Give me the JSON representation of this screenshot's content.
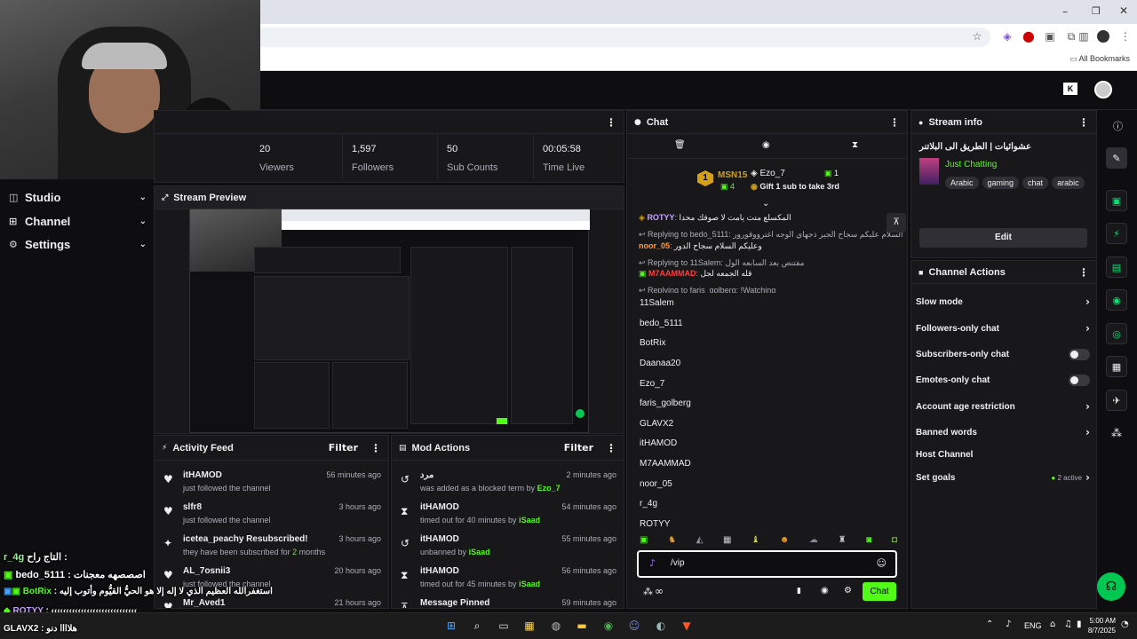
{
  "browser": {
    "bookmarks_label": "All Bookmarks"
  },
  "left_nav": [
    {
      "label": "Studio",
      "icon": "studio-icon"
    },
    {
      "label": "Channel",
      "icon": "channel-icon"
    },
    {
      "label": "Settings",
      "icon": "gear-icon"
    }
  ],
  "stats": [
    {
      "value": "20",
      "label": "Viewers"
    },
    {
      "value": "1,597",
      "label": "Followers"
    },
    {
      "value": "50",
      "label": "Sub Counts"
    },
    {
      "value": "00:05:58",
      "label": "Time Live"
    }
  ],
  "stream_preview": {
    "title": "Stream Preview"
  },
  "activity_feed": {
    "title": "Activity Feed",
    "filter": "Filter",
    "items": [
      {
        "name": "itHAMOD",
        "desc": "just followed the channel",
        "time": "56 minutes ago",
        "icon": "heart-icon"
      },
      {
        "name": "slfr8",
        "desc": "just followed the channel",
        "time": "3 hours ago",
        "icon": "heart-icon"
      },
      {
        "name": "icetea_peachy Resubscribed!",
        "desc": "they have been subscribed for",
        "desc_highlight": "2",
        "desc_suffix": "months",
        "time": "3 hours ago",
        "icon": "sparkle-icon"
      },
      {
        "name": "AL_7osnii3",
        "desc": "just followed the channel",
        "time": "20 hours ago",
        "icon": "heart-icon"
      },
      {
        "name": "Mr_Aved1",
        "desc": "",
        "time": "21 hours ago",
        "icon": "heart-icon"
      }
    ]
  },
  "mod_actions": {
    "title": "Mod Actions",
    "filter": "Filter",
    "items": [
      {
        "name": "مرد",
        "desc": "was added as a blocked term by",
        "by": "Ezo_7",
        "time": "2 minutes ago",
        "icon": "undo-icon"
      },
      {
        "name": "itHAMOD",
        "desc": "timed out for 40 minutes by",
        "by": "iSaad",
        "time": "54 minutes ago",
        "icon": "hourglass-icon"
      },
      {
        "name": "itHAMOD",
        "desc": "unbanned by",
        "by": "iSaad",
        "time": "55 minutes ago",
        "icon": "undo-icon"
      },
      {
        "name": "itHAMOD",
        "desc": "timed out for 45 minutes by",
        "by": "iSaad",
        "time": "56 minutes ago",
        "icon": "hourglass-icon"
      },
      {
        "name": "Message Pinned",
        "desc": "",
        "by": "",
        "time": "59 minutes ago",
        "icon": "pin-icon"
      }
    ]
  },
  "chat": {
    "title": "Chat",
    "leader1": {
      "name": "MSN15",
      "rank": "1",
      "count": "4"
    },
    "leader2": {
      "name": "Ezo_7",
      "count": "1"
    },
    "gift_text": "Gift 1 sub to take 3rd",
    "messages": [
      {
        "user": "ROTYY",
        "text": "المكسلع متت يامت لا صوفك محدا"
      },
      {
        "reply": "Replying to bedo_5111: السلام عليكم سجاح الجير ذجهاي الوجه اغترووقورور"
      },
      {
        "user": "noor_05",
        "text": "وعليكم السلام سجاح الدور"
      },
      {
        "reply": "Replying to 11Salem: مفتنص بعد السابعه الول"
      },
      {
        "user": "M7AAMMAD",
        "text": "قله الجمعه لجل"
      },
      {
        "reply": "Replying to faris_golberg: !Watching"
      }
    ],
    "users": [
      "11Salem",
      "bedo_5111",
      "BotRix",
      "Daanaa20",
      "Ezo_7",
      "faris_golberg",
      "GLAVX2",
      "itHAMOD",
      "M7AAMMAD",
      "noor_05",
      "r_4g",
      "ROTYY"
    ],
    "input_value": "/vip",
    "send_label": "Chat"
  },
  "stream_info": {
    "title": "Stream info",
    "stream_title": "عشوائيات | الطريق الى البلاتنر",
    "category": "Just Chatting",
    "tags": [
      "Arabic",
      "gaming",
      "chat",
      "arabic"
    ],
    "edit_label": "Edit"
  },
  "channel_actions": {
    "title": "Channel Actions",
    "items": [
      {
        "label": "Slow mode",
        "type": "chevron"
      },
      {
        "label": "Followers-only chat",
        "type": "chevron"
      },
      {
        "label": "Subscribers-only chat",
        "type": "toggle"
      },
      {
        "label": "Emotes-only chat",
        "type": "toggle"
      },
      {
        "label": "Account age restriction",
        "type": "chevron"
      },
      {
        "label": "Banned words",
        "type": "chevron"
      },
      {
        "label": "Host Channel",
        "type": "none"
      },
      {
        "label": "Set goals",
        "type": "chevron",
        "badge": "2 active"
      }
    ]
  },
  "overlay_chat": [
    {
      "user": "r_4g",
      "text": "التاج راح :"
    },
    {
      "user": "bedo_5111",
      "text": ": اصصصهه معجنات"
    },
    {
      "user": "BotRix",
      "text": ": استغفرالله العظيم الذي لا إله إلا هو الحيُّ القيُّوم وأتوب إليه"
    },
    {
      "user": "ROTYY",
      "text": ": ‹‹‹‹‹‹‹‹‹‹‹‹‹‹‹‹‹‹‹‹‹‹‹‹‹‹‹‹‹"
    },
    {
      "user": "GLAVX2",
      "text": ": هلاااا دنو"
    }
  ],
  "taskbar": {
    "lang": "ENG",
    "time": "5:00 AM",
    "date": "8/7/2025"
  },
  "colors": {
    "accent": "#53fc18",
    "bg": "#0e0e10",
    "panel": "#18181b"
  }
}
